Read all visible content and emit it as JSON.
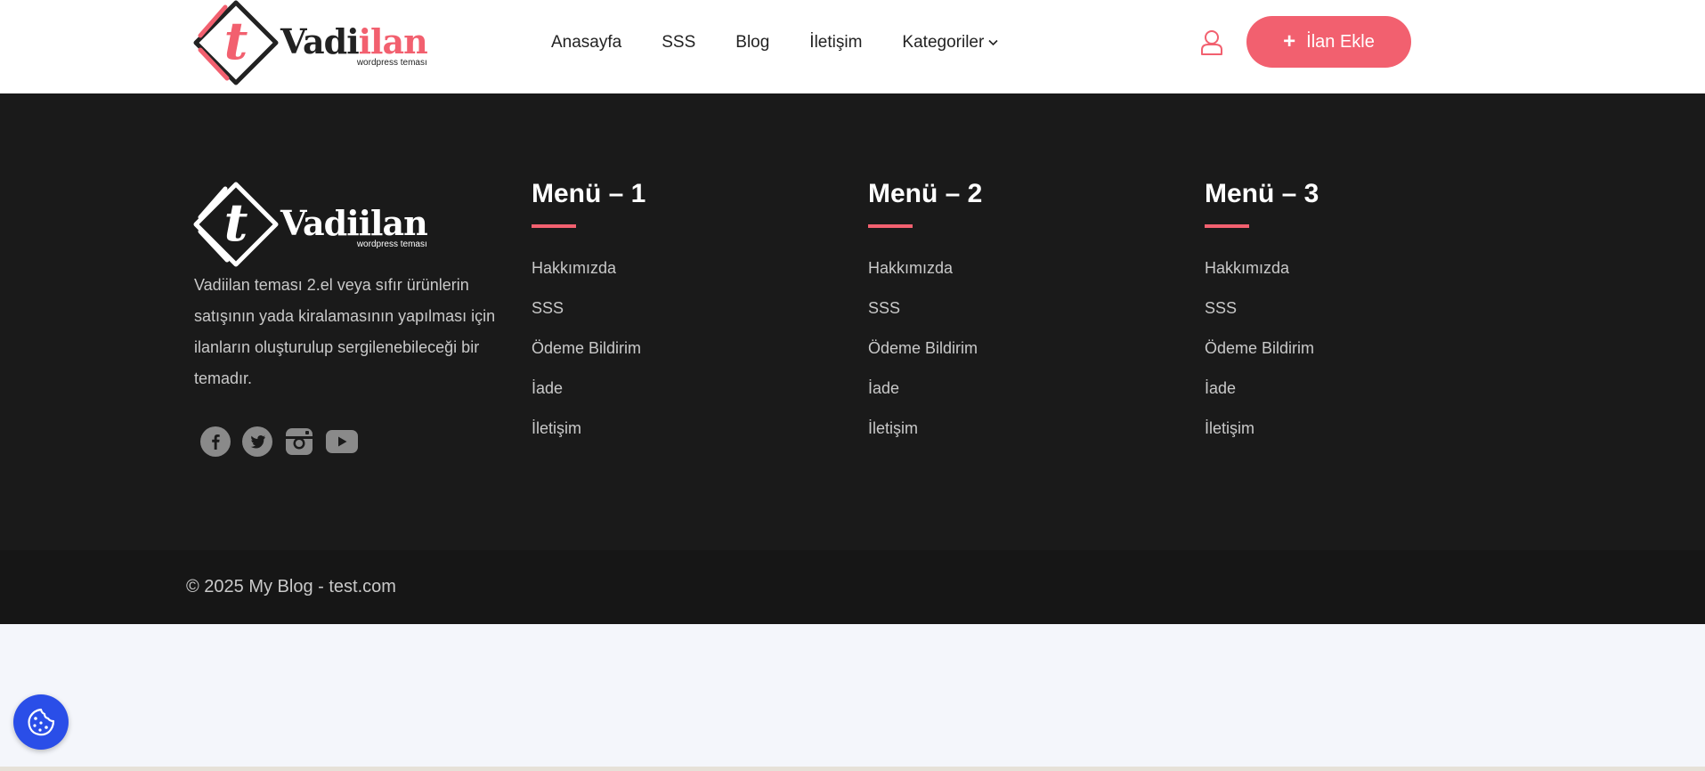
{
  "brand": {
    "name_part1": "Vadi",
    "name_part2": "ilan",
    "tagline": "wordpress teması",
    "icon_letter": "t",
    "accent_color": "#f2606f",
    "dark_color": "#222222"
  },
  "nav": {
    "items": [
      {
        "label": "Anasayfa"
      },
      {
        "label": "SSS"
      },
      {
        "label": "Blog"
      },
      {
        "label": "İletişim"
      },
      {
        "label": "Kategoriler",
        "has_dropdown": true
      }
    ],
    "chevron": "⌄"
  },
  "header": {
    "user_icon": "user-icon",
    "cta_label": "İlan Ekle",
    "cta_icon": "+"
  },
  "footer": {
    "about": "Vadiilan teması 2.el veya sıfır ürünlerin satışının yada kiralamasının yapılması için ilanların oluşturulup sergilenebileceği bir temadır.",
    "social": [
      "facebook-icon",
      "twitter-icon",
      "instagram-icon",
      "youtube-icon"
    ],
    "menus": [
      {
        "title": "Menü – 1",
        "items": [
          "Hakkımızda",
          "SSS",
          "Ödeme Bildirim",
          "İade",
          "İletişim"
        ]
      },
      {
        "title": "Menü – 2",
        "items": [
          "Hakkımızda",
          "SSS",
          "Ödeme Bildirim",
          "İade",
          "İletişim"
        ]
      },
      {
        "title": "Menü – 3",
        "items": [
          "Hakkımızda",
          "SSS",
          "Ödeme Bildirim",
          "İade",
          "İletişim"
        ]
      }
    ],
    "copyright": "© 2025 My Blog - test.com"
  },
  "cookie": {
    "icon": "cookie-icon",
    "color": "#2a4ee8"
  }
}
